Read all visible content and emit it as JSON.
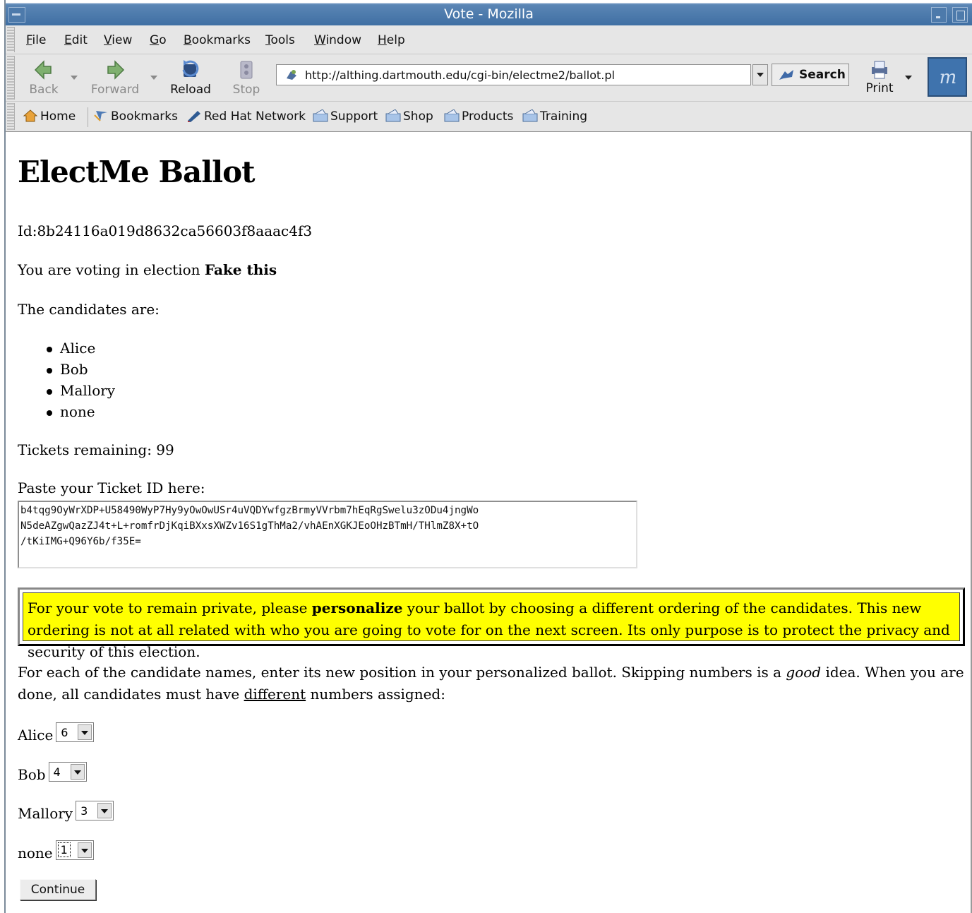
{
  "window": {
    "title": "Vote - Mozilla"
  },
  "menu": {
    "items": [
      {
        "label": "File",
        "u": "F",
        "rest": "ile"
      },
      {
        "label": "Edit",
        "u": "E",
        "rest": "dit"
      },
      {
        "label": "View",
        "u": "V",
        "rest": "iew"
      },
      {
        "label": "Go",
        "u": "G",
        "rest": "o"
      },
      {
        "label": "Bookmarks",
        "u": "B",
        "rest": "ookmarks"
      },
      {
        "label": "Tools",
        "u": "T",
        "rest": "ools"
      },
      {
        "label": "Window",
        "u": "W",
        "rest": "indow"
      },
      {
        "label": "Help",
        "u": "H",
        "rest": "elp"
      }
    ]
  },
  "nav": {
    "back": "Back",
    "forward": "Forward",
    "reload": "Reload",
    "stop": "Stop",
    "url": "http://althing.dartmouth.edu/cgi-bin/electme2/ballot.pl",
    "search": "Search",
    "print": "Print"
  },
  "bookmarks": [
    "Home",
    "Bookmarks",
    "Red Hat Network",
    "Support",
    "Shop",
    "Products",
    "Training"
  ],
  "page": {
    "heading": "ElectMe Ballot",
    "id_line": "Id:8b24116a019d8632ca56603f8aaac4f3",
    "election_prefix": "You are voting in election ",
    "election_name": "Fake this",
    "candidates_intro": "The candidates are:",
    "candidates": [
      "Alice",
      "Bob",
      "Mallory",
      "none"
    ],
    "tickets_remaining": "Tickets remaining: 99",
    "ticket_label": "Paste your Ticket ID here:",
    "ticket_value": "b4tqg9OyWrXDP+U58490WyP7Hy9yOwOwUSr4uVQDYwfgzBrmyVVrbm7hEqRgSwelu3zODu4jngWo\nN5deAZgwQazZJ4t+L+romfrDjKqiBXxsXWZv16S1gThMa2/vhAEnXGKJEoOHzBTmH/THlmZ8X+tO\n/tKiIMG+Q96Y6b/f35E=",
    "notice_pre": "For your vote to remain private, please ",
    "notice_bold": "personalize",
    "notice_post": " your ballot by choosing a different ordering of the candidates. This new ordering is not at all related with who you are going to vote for on the next screen. Its only purpose is to protect the privacy and security of this election.",
    "instr_1": "For each of the candidate names, enter its new position in your personalized ballot. Skipping numbers is a ",
    "instr_em": "good",
    "instr_2": " idea. When you are done, all candidates must have ",
    "instr_u": "different",
    "instr_3": " numbers assigned:",
    "positions": [
      {
        "name": "Alice",
        "value": "6"
      },
      {
        "name": "Bob",
        "value": "4"
      },
      {
        "name": "Mallory",
        "value": "3"
      },
      {
        "name": "none",
        "value": "1"
      }
    ],
    "continue": "Continue"
  },
  "colors": {
    "titlebar": "#4a7bb0",
    "notice_bg": "#ffff00",
    "chrome": "#e6e6e6"
  },
  "icons": [
    "back-icon",
    "forward-icon",
    "reload-icon",
    "stop-icon",
    "site-icon",
    "search-icon",
    "print-icon",
    "mozilla-logo",
    "home-icon",
    "bookmarks-icon",
    "redhat-icon",
    "folder-icon"
  ]
}
